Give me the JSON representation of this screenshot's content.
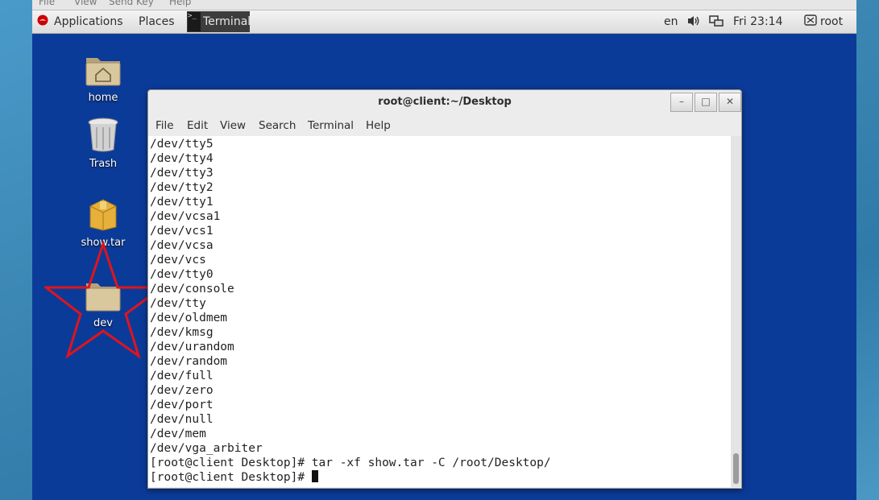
{
  "host": {
    "menu": [
      "File",
      "View",
      "Send Key",
      "Help"
    ]
  },
  "panel": {
    "applications": "Applications",
    "places": "Places",
    "task": "Terminal",
    "lang": "en",
    "clock": "Fri 23:14",
    "user": "root"
  },
  "desktop": {
    "icons": [
      {
        "label": "home"
      },
      {
        "label": "Trash"
      },
      {
        "label": "show.tar"
      },
      {
        "label": "dev"
      }
    ],
    "annotation_color": "#e0141c"
  },
  "terminal": {
    "title": "root@client:~/Desktop",
    "menu": [
      "File",
      "Edit",
      "View",
      "Search",
      "Terminal",
      "Help"
    ],
    "lines": [
      "/dev/tty5",
      "/dev/tty4",
      "/dev/tty3",
      "/dev/tty2",
      "/dev/tty1",
      "/dev/vcsa1",
      "/dev/vcs1",
      "/dev/vcsa",
      "/dev/vcs",
      "/dev/tty0",
      "/dev/console",
      "/dev/tty",
      "/dev/oldmem",
      "/dev/kmsg",
      "/dev/urandom",
      "/dev/random",
      "/dev/full",
      "/dev/zero",
      "/dev/port",
      "/dev/null",
      "/dev/mem",
      "/dev/vga_arbiter",
      "[root@client Desktop]# tar -xf show.tar -C /root/Desktop/"
    ],
    "prompt": "[root@client Desktop]# "
  },
  "colors": {
    "desktop_bg": "#0b3b99",
    "panel_bg": "#e6e6e6"
  }
}
